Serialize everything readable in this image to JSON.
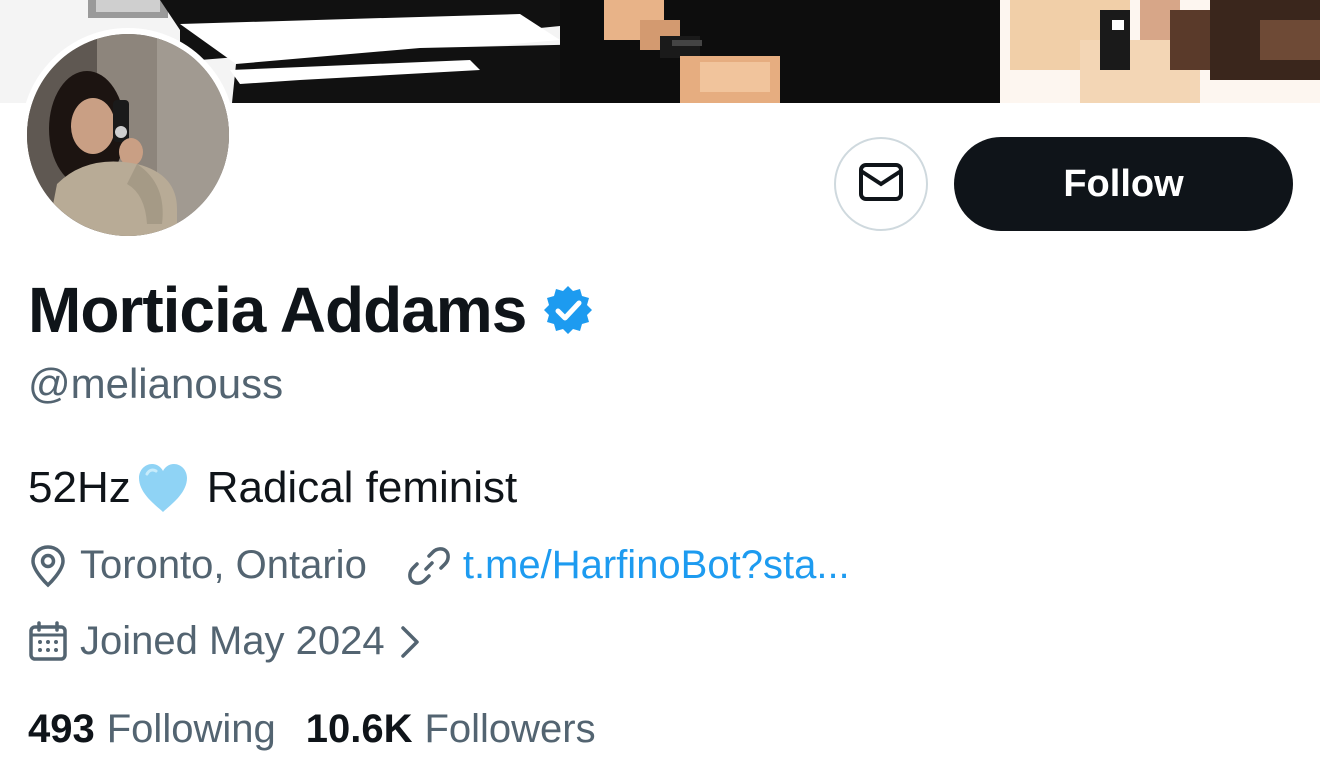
{
  "profile": {
    "display_name": "Morticia Addams",
    "handle": "@melianouss",
    "bio_prefix": "52Hz",
    "bio_suffix": "Radical feminist",
    "location": "Toronto, Ontario",
    "website": "t.me/HarfinoBot?sta...",
    "joined": "Joined May 2024",
    "following_count": "493",
    "following_label": "Following",
    "followers_count": "10.6K",
    "followers_label": "Followers"
  },
  "actions": {
    "follow_label": "Follow"
  },
  "icons": {
    "message": "envelope-icon",
    "verified": "verified-badge-icon",
    "bio_emoji": "light-blue-heart-icon",
    "location": "location-pin-icon",
    "website": "link-icon",
    "joined": "calendar-icon",
    "joined_more": "chevron-right-icon"
  },
  "colors": {
    "accent": "#1d9bf0",
    "text_primary": "#0f1419",
    "text_secondary": "#536471",
    "follow_bg": "#0f1419",
    "verified": "#1d9bf0"
  }
}
